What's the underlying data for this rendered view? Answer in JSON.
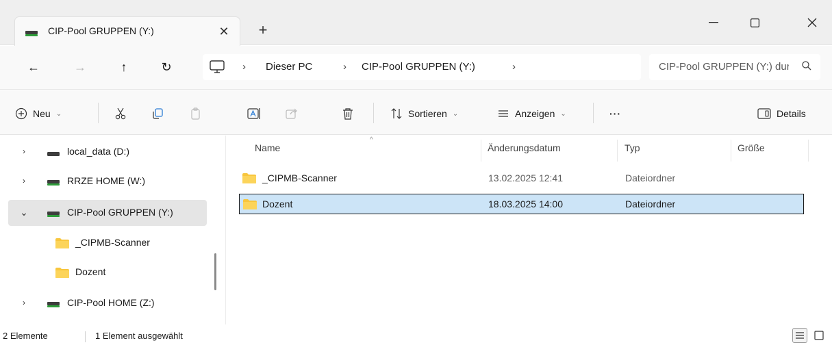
{
  "tab": {
    "title": "CIP-Pool GRUPPEN (Y:)",
    "close_glyph": "✕",
    "new_tab_glyph": "+"
  },
  "window_controls": {
    "minimize_glyph": "—",
    "close_glyph": "✕"
  },
  "nav": {
    "back_glyph": "←",
    "forward_glyph": "→",
    "up_glyph": "↑",
    "refresh_glyph": "↻"
  },
  "breadcrumb": {
    "sep": "›",
    "items": [
      "Dieser PC",
      "CIP-Pool GRUPPEN (Y:)"
    ]
  },
  "search": {
    "placeholder": "CIP-Pool GRUPPEN (Y:) durchsuchen"
  },
  "commands": {
    "new_label": "Neu",
    "sort_label": "Sortieren",
    "view_label": "Anzeigen",
    "more_label": "···",
    "details_label": "Details",
    "chevron": "⌄"
  },
  "sidebar": {
    "items": [
      {
        "label": "local_data (D:)",
        "caret": "›"
      },
      {
        "label": "RRZE HOME (W:)",
        "caret": "›"
      },
      {
        "label": "CIP-Pool GRUPPEN (Y:)",
        "caret": "⌄"
      },
      {
        "label": "_CIPMB-Scanner"
      },
      {
        "label": "Dozent"
      },
      {
        "label": "CIP-Pool HOME (Z:)",
        "caret": "›"
      }
    ]
  },
  "table": {
    "columns": [
      "Name",
      "Änderungsdatum",
      "Typ",
      "Größe"
    ],
    "sort_glyph": "^",
    "rows": [
      {
        "name": "_CIPMB-Scanner",
        "date": "13.02.2025 12:41",
        "type": "Dateiordner",
        "size": ""
      },
      {
        "name": "Dozent",
        "date": "18.03.2025 14:00",
        "type": "Dateiordner",
        "size": ""
      }
    ]
  },
  "status": {
    "count": "2 Elemente",
    "selection": "1 Element ausgewählt"
  },
  "colors": {
    "selection": "#cce4f7",
    "folder": "#f8c63d",
    "drive_green": "#2e9c3a"
  }
}
